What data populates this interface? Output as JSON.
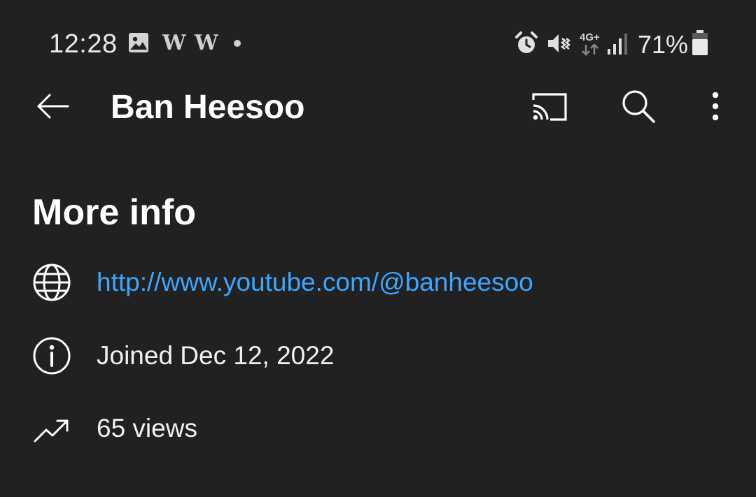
{
  "status_bar": {
    "time": "12:28",
    "notification_w1": "W",
    "notification_w2": "W",
    "network": "4G+",
    "battery_percent": "71%",
    "icons": [
      "image-notification-icon",
      "alarm-icon",
      "vibrate-mute-icon",
      "4g-plus-data-icon",
      "signal-bars-icon",
      "battery-icon"
    ]
  },
  "app_bar": {
    "title": "Ban Heesoo",
    "icons": [
      "back-arrow-icon",
      "cast-icon",
      "search-icon",
      "more-vert-icon"
    ]
  },
  "more_info": {
    "title": "More info",
    "link": "http://www.youtube.com/@banheesoo",
    "joined": "Joined Dec 12, 2022",
    "views": "65 views",
    "icons": [
      "globe-icon",
      "info-icon",
      "trending-up-icon"
    ]
  },
  "colors": {
    "background": "#212121",
    "text": "#ffffff",
    "link": "#3ea6ff"
  }
}
